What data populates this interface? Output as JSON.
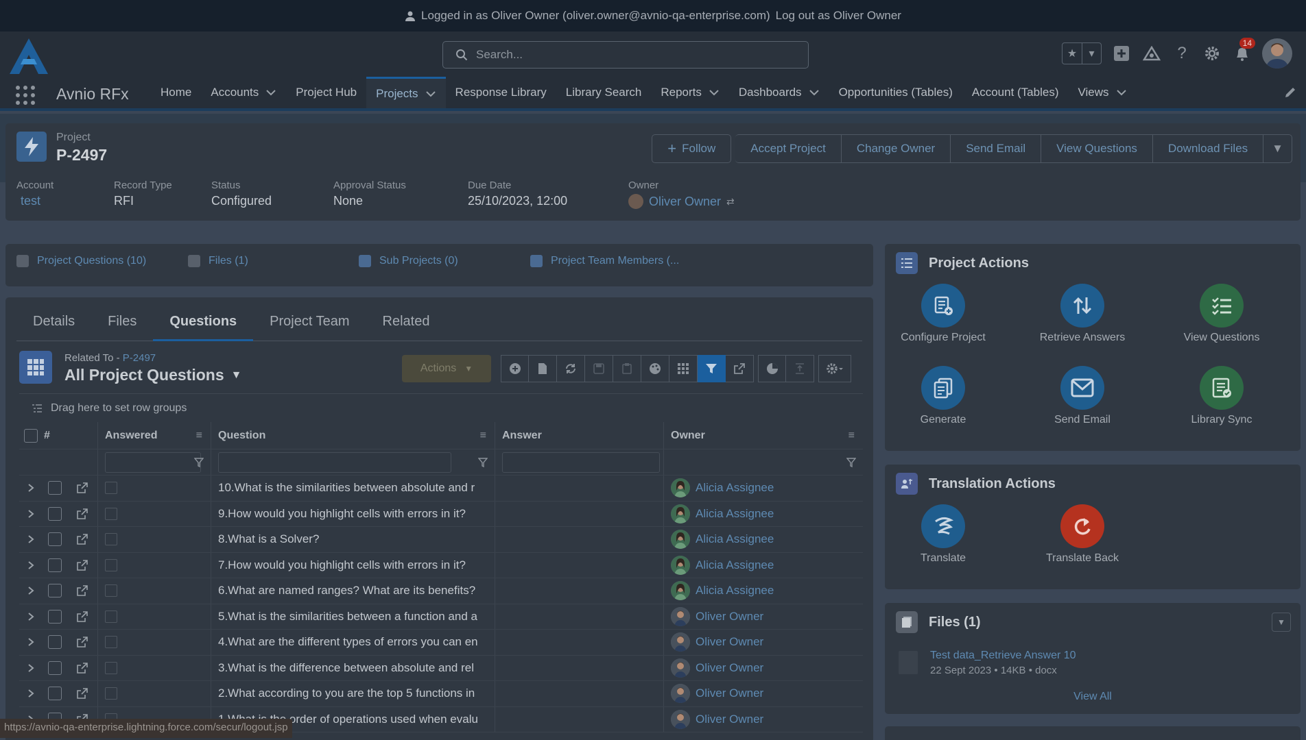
{
  "banner": {
    "prefix": "Logged in as Oliver Owner (oliver.owner@avnio-qa-enterprise.com)",
    "logout": "Log out as Oliver Owner"
  },
  "search": {
    "placeholder": "Search..."
  },
  "notifications": {
    "count": "14"
  },
  "nav": {
    "app_name": "Avnio RFx",
    "items": [
      {
        "label": "Home",
        "menu": false
      },
      {
        "label": "Accounts",
        "menu": true
      },
      {
        "label": "Project Hub",
        "menu": false
      },
      {
        "label": "Projects",
        "menu": true,
        "active": true
      },
      {
        "label": "Response Library",
        "menu": false
      },
      {
        "label": "Library Search",
        "menu": false
      },
      {
        "label": "Reports",
        "menu": true
      },
      {
        "label": "Dashboards",
        "menu": true
      },
      {
        "label": "Opportunities (Tables)",
        "menu": false
      },
      {
        "label": "Account (Tables)",
        "menu": false
      },
      {
        "label": "Views",
        "menu": true
      }
    ]
  },
  "record": {
    "type": "Project",
    "title": "P-2497",
    "buttons": {
      "follow": "Follow",
      "accept": "Accept Project",
      "change_owner": "Change Owner",
      "send_email": "Send Email",
      "view_questions": "View Questions",
      "download": "Download Files"
    },
    "fields": [
      {
        "label": "Account",
        "value": "test",
        "link": true
      },
      {
        "label": "Record Type",
        "value": "RFI",
        "link": false
      },
      {
        "label": "Status",
        "value": "Configured",
        "link": false
      },
      {
        "label": "Approval Status",
        "value": "None",
        "link": false
      },
      {
        "label": "Due Date",
        "value": "25/10/2023, 12:00",
        "link": false
      },
      {
        "label": "Owner",
        "value": "Oliver Owner",
        "link": true
      }
    ]
  },
  "related_tabs": [
    {
      "label": "Project Questions (10)"
    },
    {
      "label": "Files (1)"
    },
    {
      "label": "Sub Projects (0)"
    },
    {
      "label": "Project Team Members (..."
    }
  ],
  "tabs": [
    {
      "label": "Details"
    },
    {
      "label": "Files"
    },
    {
      "label": "Questions",
      "active": true
    },
    {
      "label": "Project Team"
    },
    {
      "label": "Related"
    }
  ],
  "listview": {
    "related_prefix": "Related To - ",
    "related_link": "P-2497",
    "name": "All Project Questions",
    "actions_label": "Actions",
    "row_group_hint": "Drag here to set row groups",
    "columns": {
      "num": "#",
      "answered": "Answered",
      "question": "Question",
      "answer": "Answer",
      "owner": "Owner"
    },
    "rows": [
      {
        "question": "10.What is the similarities between absolute and r",
        "owner": "Alicia Assignee"
      },
      {
        "question": "9.How would you highlight cells with errors in it?",
        "owner": "Alicia Assignee"
      },
      {
        "question": "8.What is a Solver?",
        "owner": "Alicia Assignee"
      },
      {
        "question": "7.How would you highlight cells with errors in it?",
        "owner": "Alicia Assignee"
      },
      {
        "question": "6.What are named ranges? What are its benefits?",
        "owner": "Alicia Assignee"
      },
      {
        "question": "5.What is the similarities between a function and a",
        "owner": "Oliver Owner"
      },
      {
        "question": "4.What are the different types of errors you can en",
        "owner": "Oliver Owner"
      },
      {
        "question": "3.What is the difference between absolute and rel",
        "owner": "Oliver Owner"
      },
      {
        "question": "2.What according to you are the top 5 functions in",
        "owner": "Oliver Owner"
      },
      {
        "question": "1.What is the order of operations used when evalu",
        "owner": "Oliver Owner"
      }
    ]
  },
  "project_actions": {
    "title": "Project Actions",
    "items": [
      {
        "label": "Configure Project",
        "icon": "configure-icon",
        "color": "#1f5d8e"
      },
      {
        "label": "Retrieve Answers",
        "icon": "retrieve-icon",
        "color": "#1f5d8e"
      },
      {
        "label": "View Questions",
        "icon": "list-check-icon",
        "color": "#2e6a45"
      },
      {
        "label": "Generate",
        "icon": "copy-icon",
        "color": "#1f5d8e"
      },
      {
        "label": "Send Email",
        "icon": "mail-icon",
        "color": "#1f5d8e"
      },
      {
        "label": "Library Sync",
        "icon": "library-sync-icon",
        "color": "#2e6a45"
      }
    ]
  },
  "translation_actions": {
    "title": "Translation Actions",
    "items": [
      {
        "label": "Translate",
        "icon": "translate-icon",
        "color": "#1f5d8e"
      },
      {
        "label": "Translate Back",
        "icon": "translate-back-icon",
        "color": "#b5321f"
      }
    ]
  },
  "files_card": {
    "title": "Files (1)",
    "file_name": "Test data_Retrieve Answer 10",
    "file_meta": "22 Sept 2023 • 14KB • docx",
    "view_all": "View All"
  },
  "status_url": "https://avnio-qa-enterprise.lightning.force.com/secur/logout.jsp"
}
